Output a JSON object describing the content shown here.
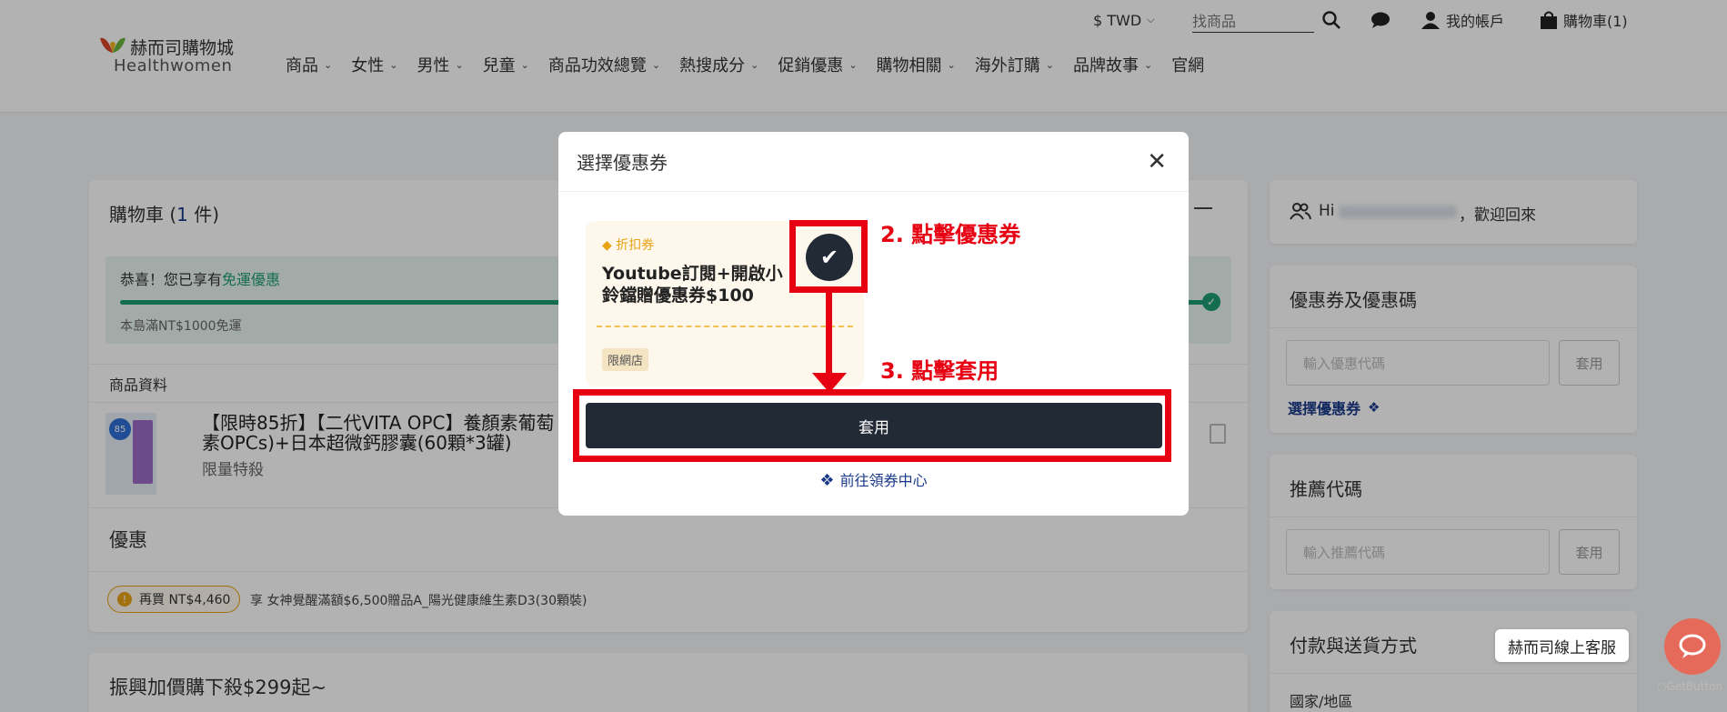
{
  "header": {
    "logo_cn": "赫而司購物城",
    "logo_en": "Healthwomen",
    "currency": "$ TWD",
    "search_placeholder": "找商品",
    "account_label": "我的帳戶",
    "cart_label": "購物車(1)",
    "nav": [
      "商品",
      "女性",
      "男性",
      "兒童",
      "商品功效總覽",
      "熱搜成分",
      "促銷優惠",
      "購物相關",
      "海外訂購",
      "品牌故事",
      "官網"
    ]
  },
  "cart": {
    "title_prefix": "購物車 (",
    "count": "1",
    "title_suffix": " 件)",
    "free_shipping_text": "恭喜！您已享有",
    "free_shipping_link": "免運優惠",
    "free_shipping_note": "本島滿NT$1000免運",
    "product_header": "商品資料",
    "product_name": "【限時85折】【二代VITA OPC】養顏素葡萄籽素OPCs)+日本超微鈣膠囊(60顆*3罐)",
    "product_name_l1": "【限時85折】【二代VITA OPC】養顏素葡萄",
    "product_name_l2": "素OPCs)+日本超微鈣膠囊(60顆*3罐)",
    "product_tag": "限量特殺",
    "promo_title": "優惠",
    "promo_badge": "再買 NT$4,460",
    "promo_text": "享 女神覺醒滿額$6,500贈品A_陽光健康維生素D3(30顆裝)",
    "addon_title": "振興加價購下殺$299起~"
  },
  "sidebar": {
    "greeting_prefix": "Hi",
    "greeting_suffix": "，歡迎回來",
    "coupon_title": "優惠券及優惠碼",
    "coupon_placeholder": "輸入優惠代碼",
    "apply_label": "套用",
    "choose_coupon": "選擇優惠券",
    "referral_title": "推薦代碼",
    "referral_placeholder": "輸入推薦代碼",
    "payment_title": "付款與送貨方式",
    "country_label": "國家/地區"
  },
  "modal": {
    "title": "選擇優惠券",
    "coupon_type": "折扣券",
    "coupon_name": "Youtube訂閱+開啟小鈴鐺贈優惠券$100",
    "coupon_name_l1": "Youtube訂閱+開啟小",
    "coupon_name_l2": "鈴鐺贈優惠券$100",
    "coupon_limit": "限網店",
    "apply_button": "套用",
    "goto_center": "前往領券中心"
  },
  "annotations": {
    "step2": "2. 點擊優惠券",
    "step3": "3. 點擊套用"
  },
  "chat": {
    "label": "赫而司線上客服",
    "brand": "GetButton"
  },
  "colors": {
    "accent_dark": "#222a36",
    "annotation_red": "#e60012",
    "progress_green": "#1f9d74",
    "link_blue": "#1b3a8a",
    "coupon_orange": "#e8a317"
  },
  "free_shipping_progress": 1.0
}
